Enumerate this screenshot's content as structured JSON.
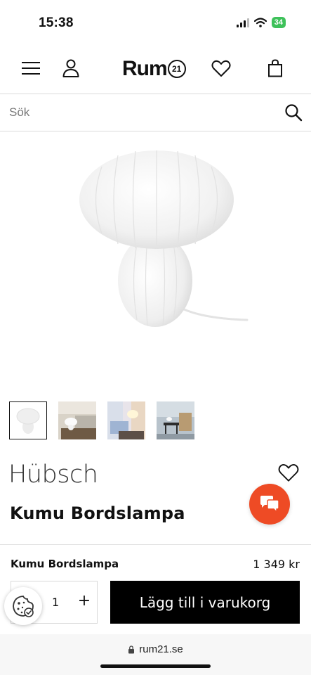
{
  "status": {
    "time": "15:38",
    "battery": "34"
  },
  "header": {
    "logo_text": "Rum",
    "logo_badge": "21"
  },
  "search": {
    "placeholder": "Sök"
  },
  "product": {
    "brand": "Hübsch",
    "title": "Kumu Bordslampa",
    "thumbnail_count": 4
  },
  "purchase_bar": {
    "name": "Kumu Bordslampa",
    "price": "1 349 kr",
    "quantity": "1",
    "plus_label": "+",
    "add_to_cart_label": "Lägg till i varukorg"
  },
  "browser": {
    "url": "rum21.se"
  },
  "colors": {
    "accent_chat": "#ee4b25",
    "cta_background": "#000000",
    "battery": "#3ec15a"
  },
  "icons": {
    "header": [
      "menu-icon",
      "user-icon",
      "heart-icon",
      "shopping-bag-icon"
    ],
    "search": "search-icon",
    "chat": "chat-bubbles-icon",
    "cookie": "cookie-icon",
    "lock": "lock-icon"
  }
}
